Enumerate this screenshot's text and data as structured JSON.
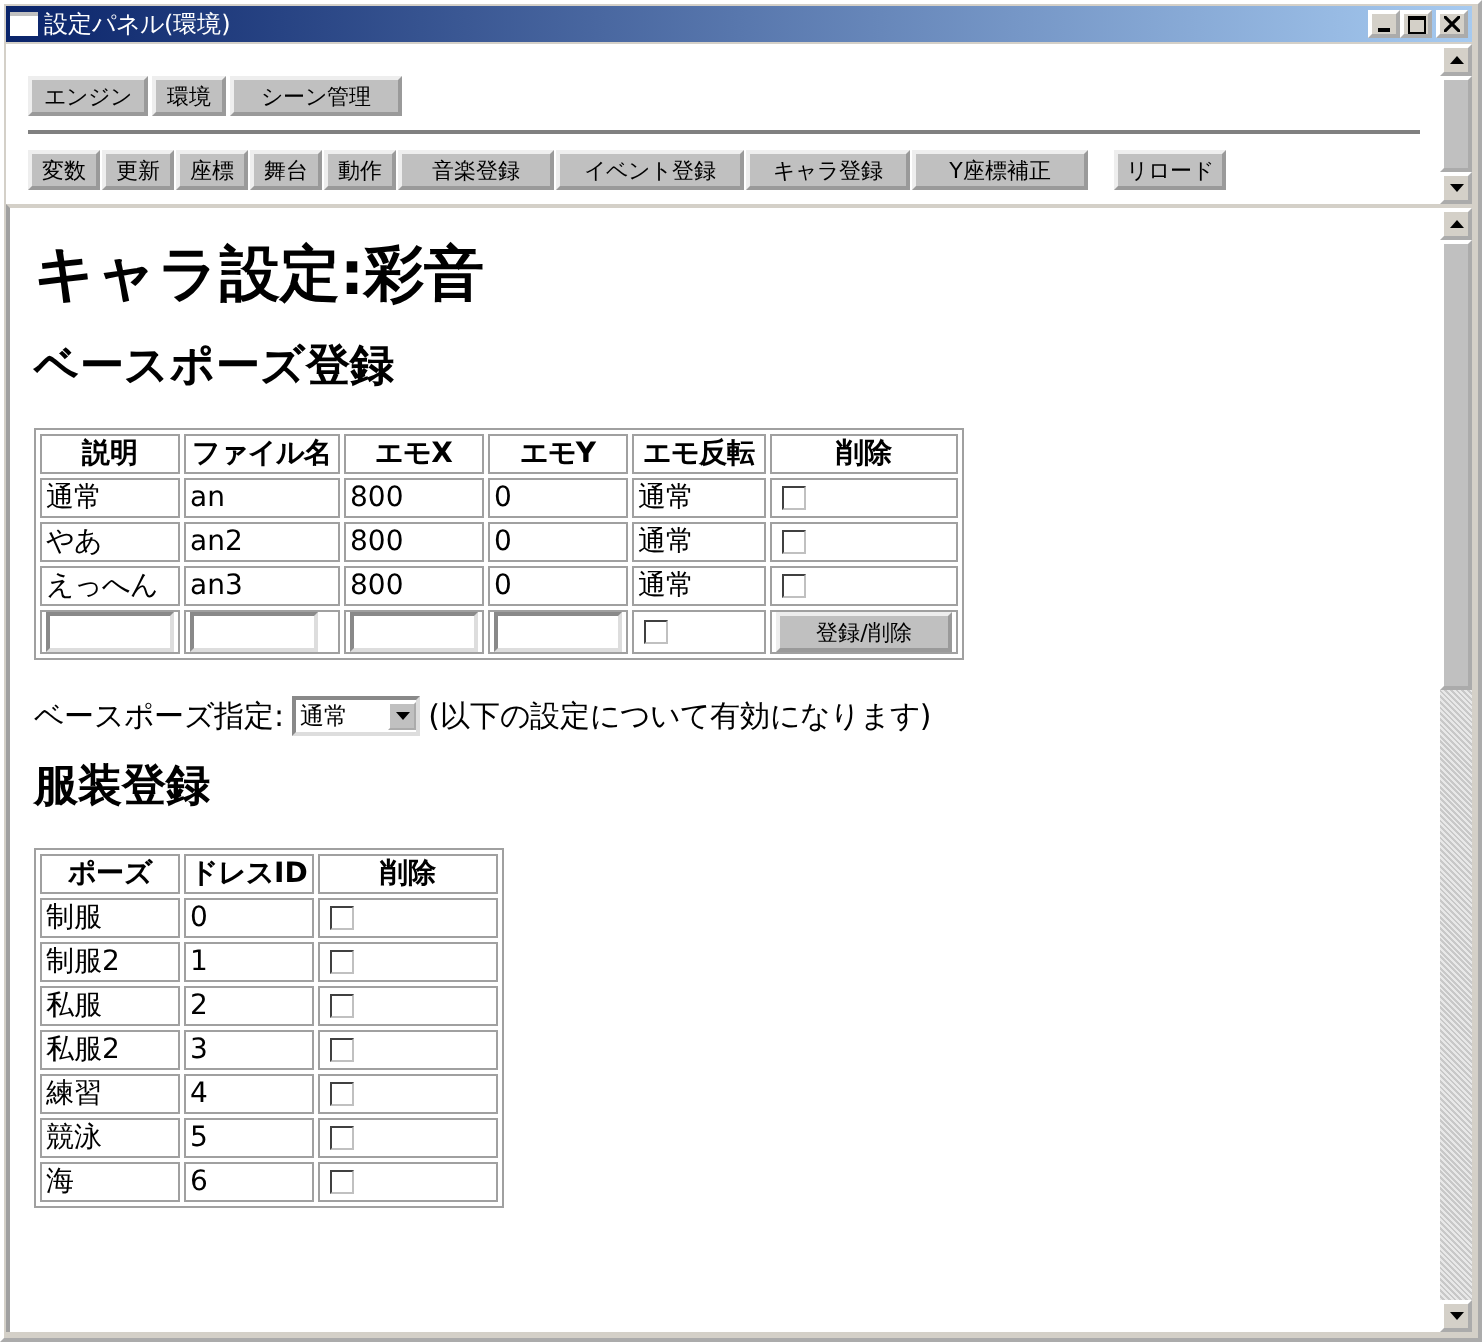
{
  "window": {
    "title": "設定パネル(環境)"
  },
  "nav_buttons": [
    "エンジン",
    "環境",
    "シーン管理"
  ],
  "menu_buttons": [
    "変数",
    "更新",
    "座標",
    "舞台",
    "動作",
    "音楽登録",
    "イベント登録",
    "キャラ登録",
    "Y座標補正"
  ],
  "reload_button": "リロード",
  "heading": "キャラ設定:彩音",
  "base_pose": {
    "heading": "ベースポーズ登録",
    "columns": [
      "説明",
      "ファイル名",
      "エモX",
      "エモY",
      "エモ反転",
      "削除"
    ],
    "rows": [
      {
        "cells": [
          "通常",
          "an",
          "800",
          "0",
          "通常"
        ],
        "checked": false
      },
      {
        "cells": [
          "やあ",
          "an2",
          "800",
          "0",
          "通常"
        ],
        "checked": false
      },
      {
        "cells": [
          "えっへん",
          "an3",
          "800",
          "0",
          "通常"
        ],
        "checked": false
      }
    ],
    "new_row": {
      "flip_checked": false,
      "button": "登録/削除"
    }
  },
  "base_pose_select": {
    "label": "ベースポーズ指定:",
    "value": "通常",
    "note": "(以下の設定について有効になります)"
  },
  "costume": {
    "heading": "服装登録",
    "columns": [
      "ポーズ",
      "ドレスID",
      "削除"
    ],
    "rows": [
      {
        "cells": [
          "制服",
          "0"
        ],
        "checked": false
      },
      {
        "cells": [
          "制服2",
          "1"
        ],
        "checked": false
      },
      {
        "cells": [
          "私服",
          "2"
        ],
        "checked": false
      },
      {
        "cells": [
          "私服2",
          "3"
        ],
        "checked": false
      },
      {
        "cells": [
          "練習",
          "4"
        ],
        "checked": false
      },
      {
        "cells": [
          "競泳",
          "5"
        ],
        "checked": false
      },
      {
        "cells": [
          "海",
          "6"
        ],
        "checked": false
      }
    ]
  }
}
